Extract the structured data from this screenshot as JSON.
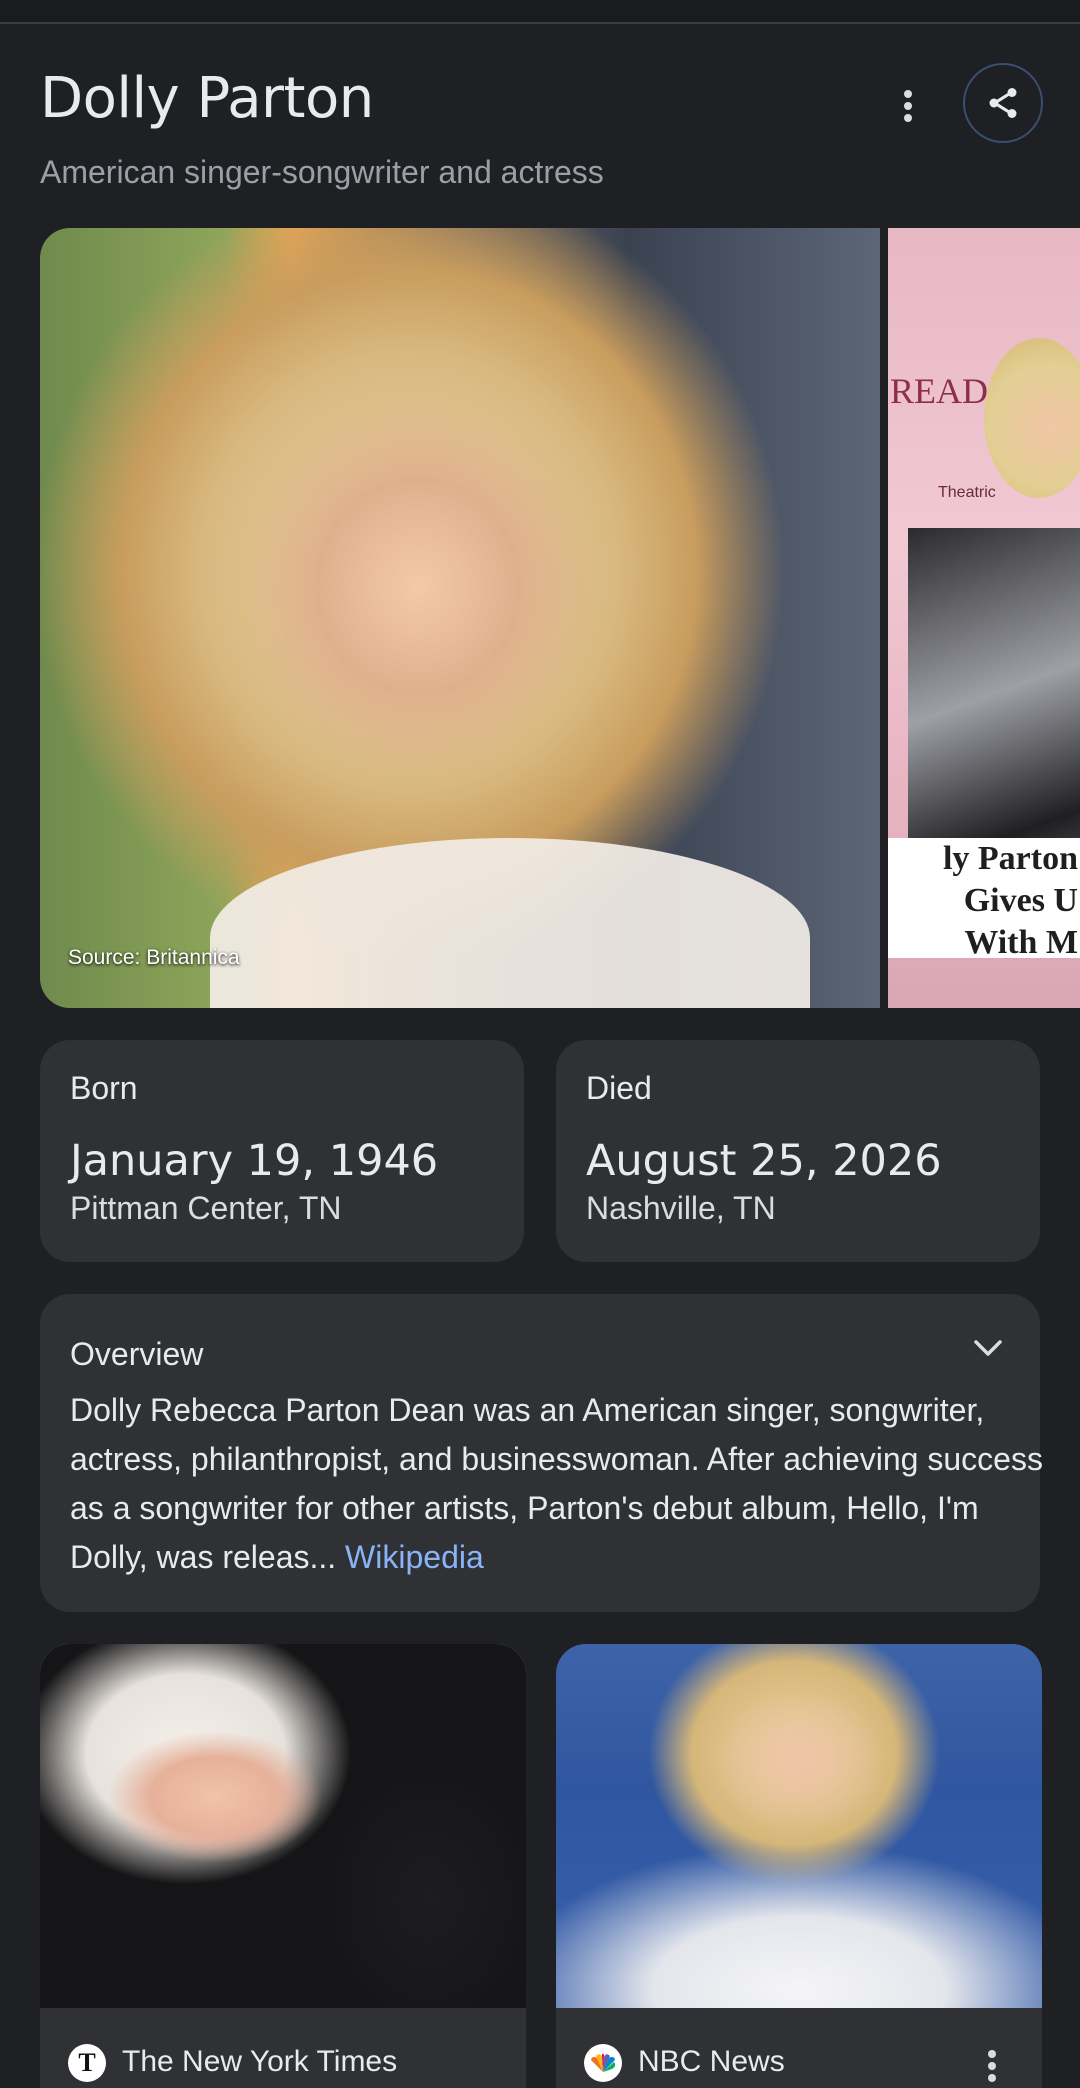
{
  "header": {
    "title": "Dolly Parton",
    "subtitle": "American singer-songwriter and actress",
    "more_icon": "more-vert-icon",
    "share_icon": "share-icon"
  },
  "hero": {
    "source": "Source: Britannica",
    "second_image_text_line1": "ly Parton Gives U",
    "second_image_text_line2": "With M",
    "second_image_brand": "READS",
    "second_image_small": "Theatric"
  },
  "born": {
    "label": "Born",
    "date": "January 19, 1946",
    "place": "Pittman Center, TN"
  },
  "died": {
    "label": "Died",
    "date": "August 25, 2026",
    "place": "Nashville, TN"
  },
  "overview": {
    "title": "Overview",
    "text": "Dolly Rebecca Parton Dean was an American singer, songwriter, actress, philanthropist, and businesswoman. After achieving success as a songwriter for other artists, Parton's debut album, Hello, I'm Dolly, was releas...",
    "link": "Wikipedia",
    "chevron_icon": "chevron-down-icon"
  },
  "news": [
    {
      "source": "The New York Times",
      "logo": "T"
    },
    {
      "source": "NBC News",
      "logo": "nbc-peacock-icon"
    }
  ]
}
